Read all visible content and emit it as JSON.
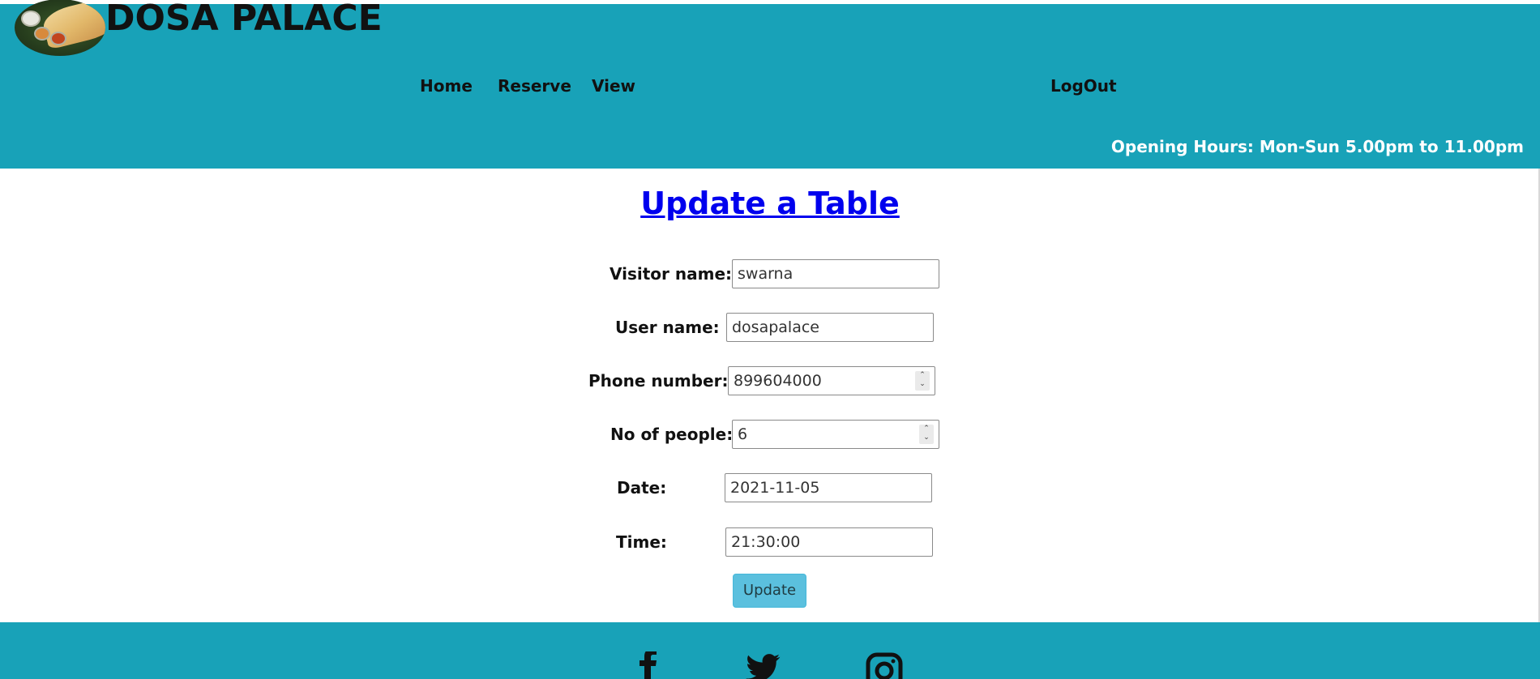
{
  "header": {
    "brand": "DOSA PALACE",
    "nav": [
      {
        "label": "Home"
      },
      {
        "label": "Reserve"
      },
      {
        "label": "View"
      }
    ],
    "logout_label": "LogOut",
    "opening_hours": "Opening Hours: Mon-Sun 5.00pm to 11.00pm",
    "bg_color": "#18a2b8"
  },
  "main": {
    "title": "Update a Table",
    "title_color": "#0000ee",
    "form": {
      "fields": [
        {
          "label": "Visitor name:",
          "value": "swarna",
          "type": "text"
        },
        {
          "label": "User name:",
          "value": "dosapalace",
          "type": "text"
        },
        {
          "label": "Phone number:",
          "value": "899604000",
          "type": "number"
        },
        {
          "label": "No of people:",
          "value": "6",
          "type": "number"
        },
        {
          "label": "Date:",
          "value": "2021-11-05",
          "type": "text"
        },
        {
          "label": "Time:",
          "value": "21:30:00",
          "type": "text"
        }
      ],
      "submit_label": "Update",
      "submit_color": "#5bc0de"
    }
  },
  "footer": {
    "bg_color": "#18a2b8",
    "social": [
      {
        "icon": "facebook-icon"
      },
      {
        "icon": "twitter-icon"
      },
      {
        "icon": "instagram-icon"
      }
    ]
  }
}
